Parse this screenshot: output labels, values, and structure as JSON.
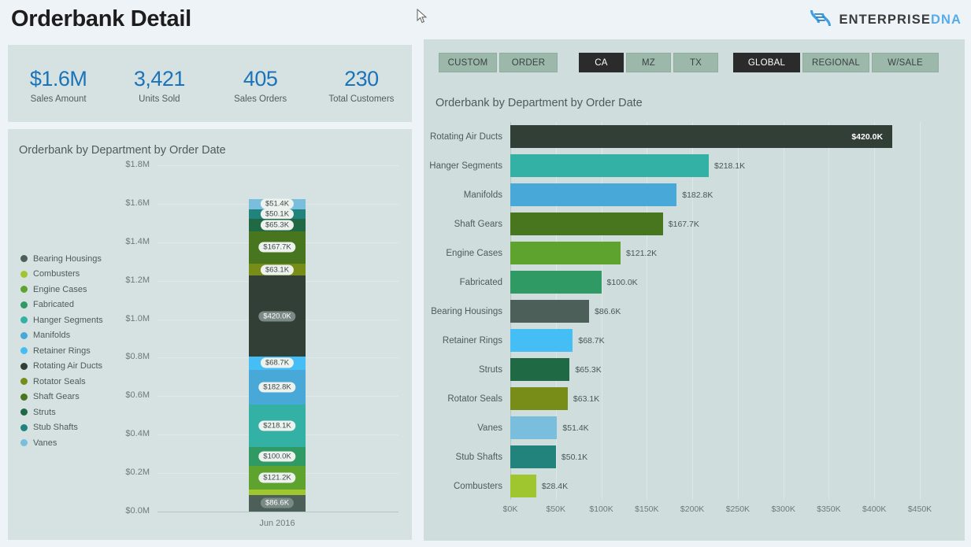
{
  "header": {
    "title": "Orderbank Detail",
    "brand_primary": "ENTERPRISE",
    "brand_secondary": "DNA",
    "brand_icon": "dna-helix-icon"
  },
  "kpis": [
    {
      "value": "$1.6M",
      "label": "Sales Amount"
    },
    {
      "value": "3,421",
      "label": "Units Sold"
    },
    {
      "value": "405",
      "label": "Sales Orders"
    },
    {
      "value": "230",
      "label": "Total Customers"
    }
  ],
  "filters": {
    "group_type": {
      "buttons": [
        {
          "label": "CUSTOM",
          "selected": false
        },
        {
          "label": "ORDER",
          "selected": false
        }
      ]
    },
    "group_region": {
      "buttons": [
        {
          "label": "CA",
          "selected": true
        },
        {
          "label": "MZ",
          "selected": false
        },
        {
          "label": "TX",
          "selected": false
        }
      ]
    },
    "group_scope": {
      "buttons": [
        {
          "label": "GLOBAL",
          "selected": true
        },
        {
          "label": "REGIONAL",
          "selected": false
        },
        {
          "label": "W/SALE",
          "selected": false
        }
      ]
    }
  },
  "colors": {
    "accent_blue": "#1b74ba",
    "panel": "#d6e2e1",
    "panel_right": "#cfdedd",
    "page_bg": "#eef3f7",
    "button_unselected": "#9cb8ab",
    "button_selected": "#2b2b2b"
  },
  "departments": [
    {
      "name": "Bearing Housings",
      "color": "#4c5f58"
    },
    {
      "name": "Combusters",
      "color": "#9fc62e"
    },
    {
      "name": "Engine Cases",
      "color": "#5ea32e"
    },
    {
      "name": "Fabricated",
      "color": "#2f9a63"
    },
    {
      "name": "Hanger Segments",
      "color": "#33b1a5"
    },
    {
      "name": "Manifolds",
      "color": "#48a8d8"
    },
    {
      "name": "Retainer Rings",
      "color": "#45bdf5"
    },
    {
      "name": "Rotating Air Ducts",
      "color": "#313f37"
    },
    {
      "name": "Rotator Seals",
      "color": "#788c18"
    },
    {
      "name": "Shaft Gears",
      "color": "#47761f"
    },
    {
      "name": "Struts",
      "color": "#1f6a45"
    },
    {
      "name": "Stub Shafts",
      "color": "#21837c"
    },
    {
      "name": "Vanes",
      "color": "#79bedd"
    }
  ],
  "chart_data": [
    {
      "id": "stacked-column",
      "type": "bar",
      "title": "Orderbank by Department by Order Date",
      "stacked": true,
      "orientation": "vertical",
      "xlabel": "",
      "ylabel": "",
      "categories": [
        "Jun 2016"
      ],
      "ytick_labels": [
        "$0.0M",
        "$0.2M",
        "$0.4M",
        "$0.6M",
        "$0.8M",
        "$1.0M",
        "$1.2M",
        "$1.4M",
        "$1.6M",
        "$1.8M"
      ],
      "ylim": [
        0,
        1800000
      ],
      "grid": true,
      "legend_position": "left",
      "segments_bottom_to_top": [
        {
          "name": "Bearing Housings",
          "value": 86600,
          "label": "$86.6K",
          "color": "#4c5f58",
          "label_style": "light"
        },
        {
          "name": "Combusters",
          "value": 28400,
          "label": "$28.4K",
          "color": "#9fc62e",
          "label_style": "hidden"
        },
        {
          "name": "Engine Cases",
          "value": 121200,
          "label": "$121.2K",
          "color": "#5ea32e",
          "label_style": "normal"
        },
        {
          "name": "Fabricated",
          "value": 100000,
          "label": "$100.0K",
          "color": "#2f9a63",
          "label_style": "normal"
        },
        {
          "name": "Hanger Segments",
          "value": 218100,
          "label": "$218.1K",
          "color": "#33b1a5",
          "label_style": "normal"
        },
        {
          "name": "Manifolds",
          "value": 182800,
          "label": "$182.8K",
          "color": "#48a8d8",
          "label_style": "normal"
        },
        {
          "name": "Retainer Rings",
          "value": 68700,
          "label": "$68.7K",
          "color": "#45bdf5",
          "label_style": "normal"
        },
        {
          "name": "Rotating Air Ducts",
          "value": 420000,
          "label": "$420.0K",
          "color": "#313f37",
          "label_style": "light"
        },
        {
          "name": "Rotator Seals",
          "value": 63100,
          "label": "$63.1K",
          "color": "#788c18",
          "label_style": "normal"
        },
        {
          "name": "Shaft Gears",
          "value": 167700,
          "label": "$167.7K",
          "color": "#47761f",
          "label_style": "normal"
        },
        {
          "name": "Struts",
          "value": 65300,
          "label": "$65.3K",
          "color": "#1f6a45",
          "label_style": "normal"
        },
        {
          "name": "Stub Shafts",
          "value": 50100,
          "label": "$50.1K",
          "color": "#21837c",
          "label_style": "normal"
        },
        {
          "name": "Vanes",
          "value": 51400,
          "label": "$51.4K",
          "color": "#79bedd",
          "label_style": "normal"
        }
      ],
      "total": 1623400
    },
    {
      "id": "horizontal-bar",
      "type": "bar",
      "title": "Orderbank by Department by Order Date",
      "orientation": "horizontal",
      "xlabel": "",
      "ylabel": "",
      "xtick_labels": [
        "$0K",
        "$50K",
        "$100K",
        "$150K",
        "$200K",
        "$250K",
        "$300K",
        "$350K",
        "$400K",
        "$450K"
      ],
      "xlim": [
        0,
        450000
      ],
      "grid": true,
      "categories": [
        "Rotating Air Ducts",
        "Hanger Segments",
        "Manifolds",
        "Shaft Gears",
        "Engine Cases",
        "Fabricated",
        "Bearing Housings",
        "Retainer Rings",
        "Struts",
        "Rotator Seals",
        "Vanes",
        "Stub Shafts",
        "Combusters"
      ],
      "values": [
        420000,
        218100,
        182800,
        167700,
        121200,
        100000,
        86600,
        68700,
        65300,
        63100,
        51400,
        50100,
        28400
      ],
      "value_labels": [
        "$420.0K",
        "$218.1K",
        "$182.8K",
        "$167.7K",
        "$121.2K",
        "$100.0K",
        "$86.6K",
        "$68.7K",
        "$65.3K",
        "$63.1K",
        "$51.4K",
        "$50.1K",
        "$28.4K"
      ],
      "bar_colors": [
        "#313f37",
        "#33b1a5",
        "#48a8d8",
        "#47761f",
        "#5ea32e",
        "#2f9a63",
        "#4c5f58",
        "#45bdf5",
        "#1f6a45",
        "#788c18",
        "#79bedd",
        "#21837c",
        "#9fc62e"
      ],
      "label_placement": [
        "inside",
        "outside",
        "outside",
        "outside",
        "outside",
        "outside",
        "outside",
        "outside",
        "outside",
        "outside",
        "outside",
        "outside",
        "outside"
      ]
    }
  ]
}
